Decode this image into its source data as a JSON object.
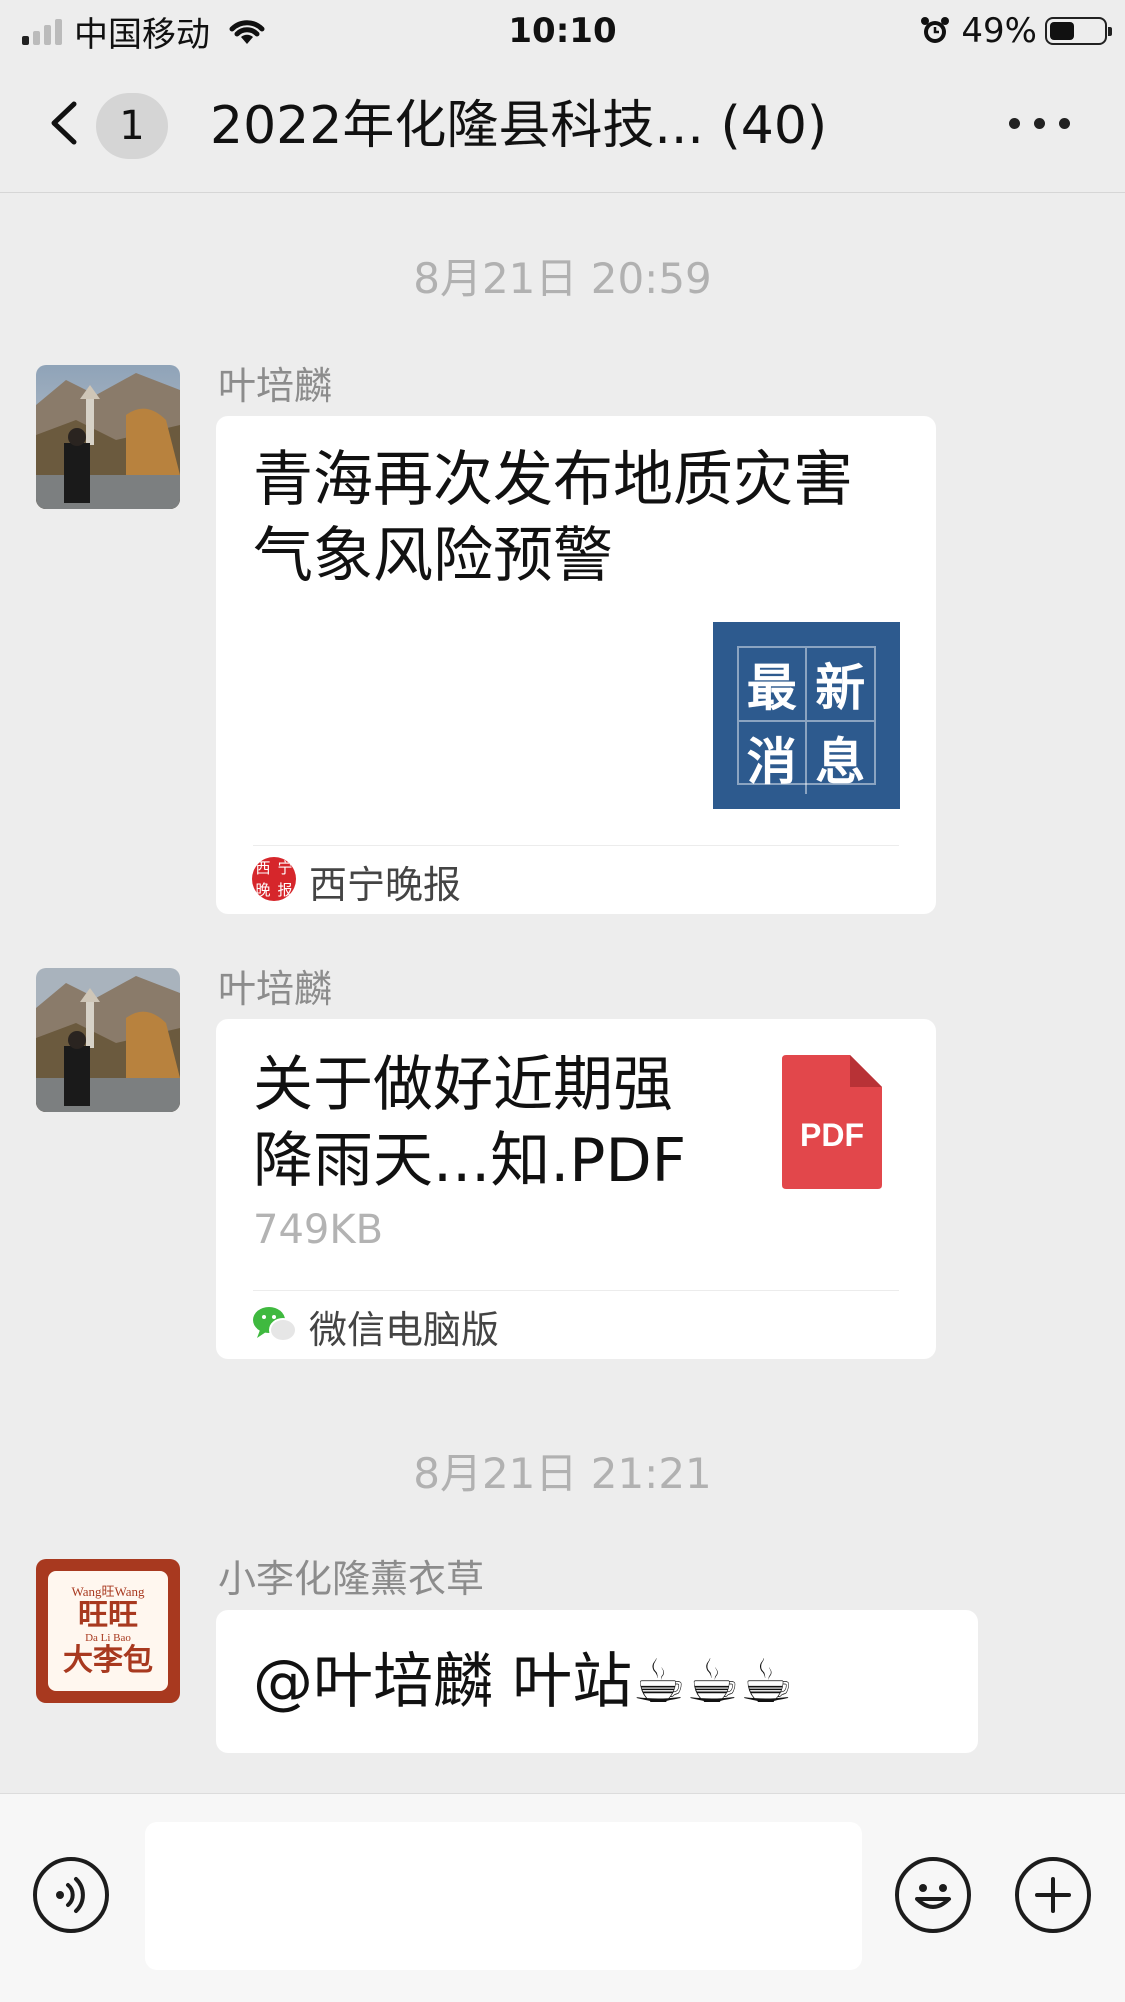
{
  "status_bar": {
    "carrier": "中国移动",
    "time": "10:10",
    "battery": "49%",
    "battery_level": 0.49
  },
  "nav": {
    "unread_count": "1",
    "title": "2022年化隆县科技... (40)"
  },
  "messages": [
    {
      "timestamp": "8月21日 20:59",
      "sender": "叶培麟",
      "type": "article",
      "title_line1": "青海再次发布地质灾害",
      "title_line2": "气象风险预警",
      "thumb_chars": [
        "最",
        "新",
        "消",
        "息"
      ],
      "source_icon_chars": [
        "西",
        "宁",
        "晚",
        "报"
      ],
      "source": "西宁晚报"
    },
    {
      "sender": "叶培麟",
      "type": "file",
      "title_line1": "关于做好近期强",
      "title_line2": "降雨天...知.PDF",
      "size": "749KB",
      "file_icon_label": "PDF",
      "source": "微信电脑版"
    },
    {
      "timestamp": "8月21日 21:21",
      "sender": "小李化隆薰衣草",
      "type": "text",
      "text": "@叶培麟 叶站☕☕☕",
      "avatar_text": [
        "Wang旺Wang",
        "旺旺",
        "Da Li Bao",
        "大李包"
      ]
    }
  ],
  "input": {
    "placeholder": ""
  },
  "colors": {
    "background": "#ededed",
    "bubble": "#ffffff",
    "pdf_red": "#e2474b",
    "news_blue": "#2d5a8e",
    "timestamp_gray": "#b1b1b1"
  }
}
